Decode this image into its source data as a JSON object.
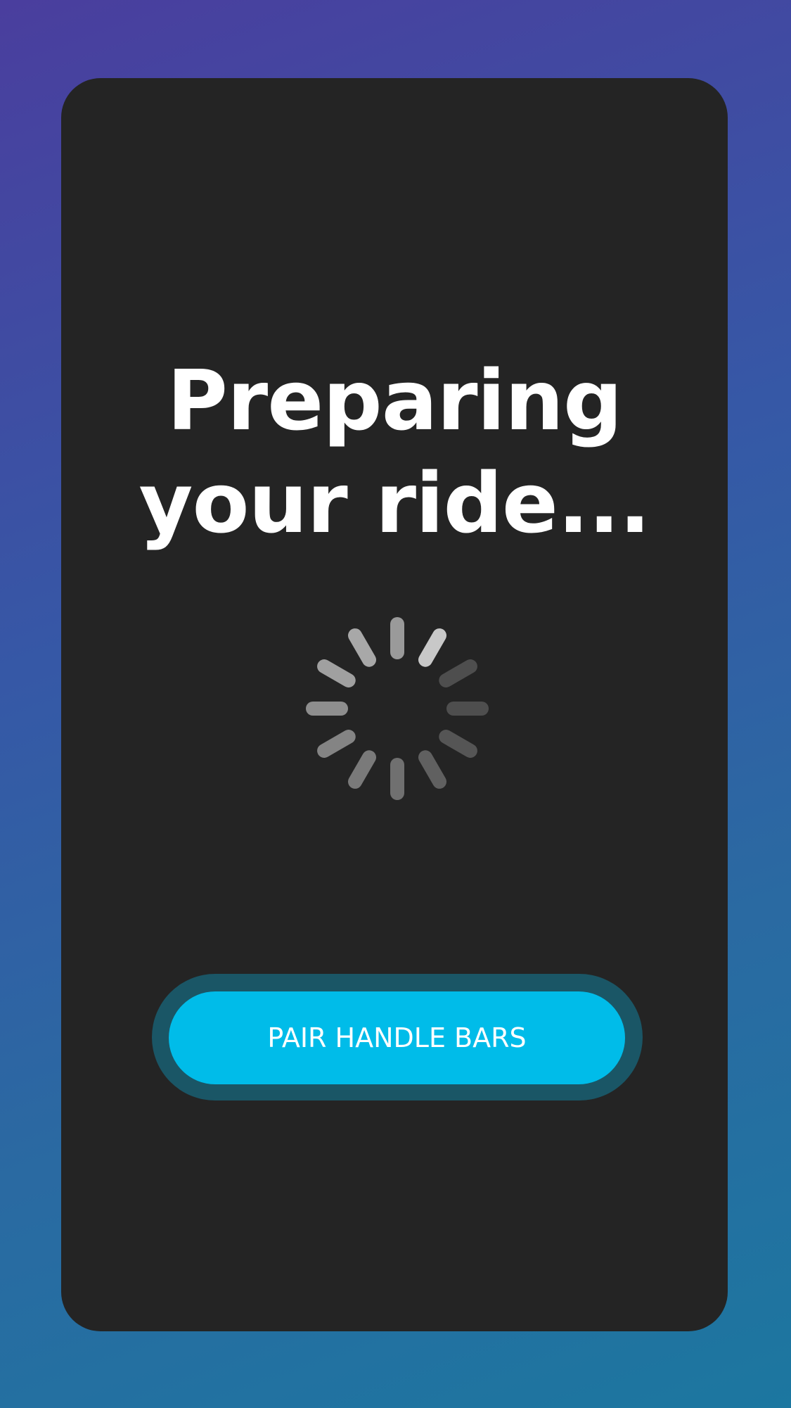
{
  "loading_screen": {
    "title_line_1": "Preparing",
    "title_line_2": "your ride...",
    "spinner_icon": "loading-spinner-icon"
  },
  "actions": {
    "pair_button_label": "PAIR HANDLE BARS"
  },
  "colors": {
    "background_gradient_start": "#4a3e9e",
    "background_gradient_end": "#1c77a0",
    "card_background": "#242424",
    "accent": "#00bce9",
    "button_ring": "#1a5666",
    "title_text": "#ffffff"
  }
}
